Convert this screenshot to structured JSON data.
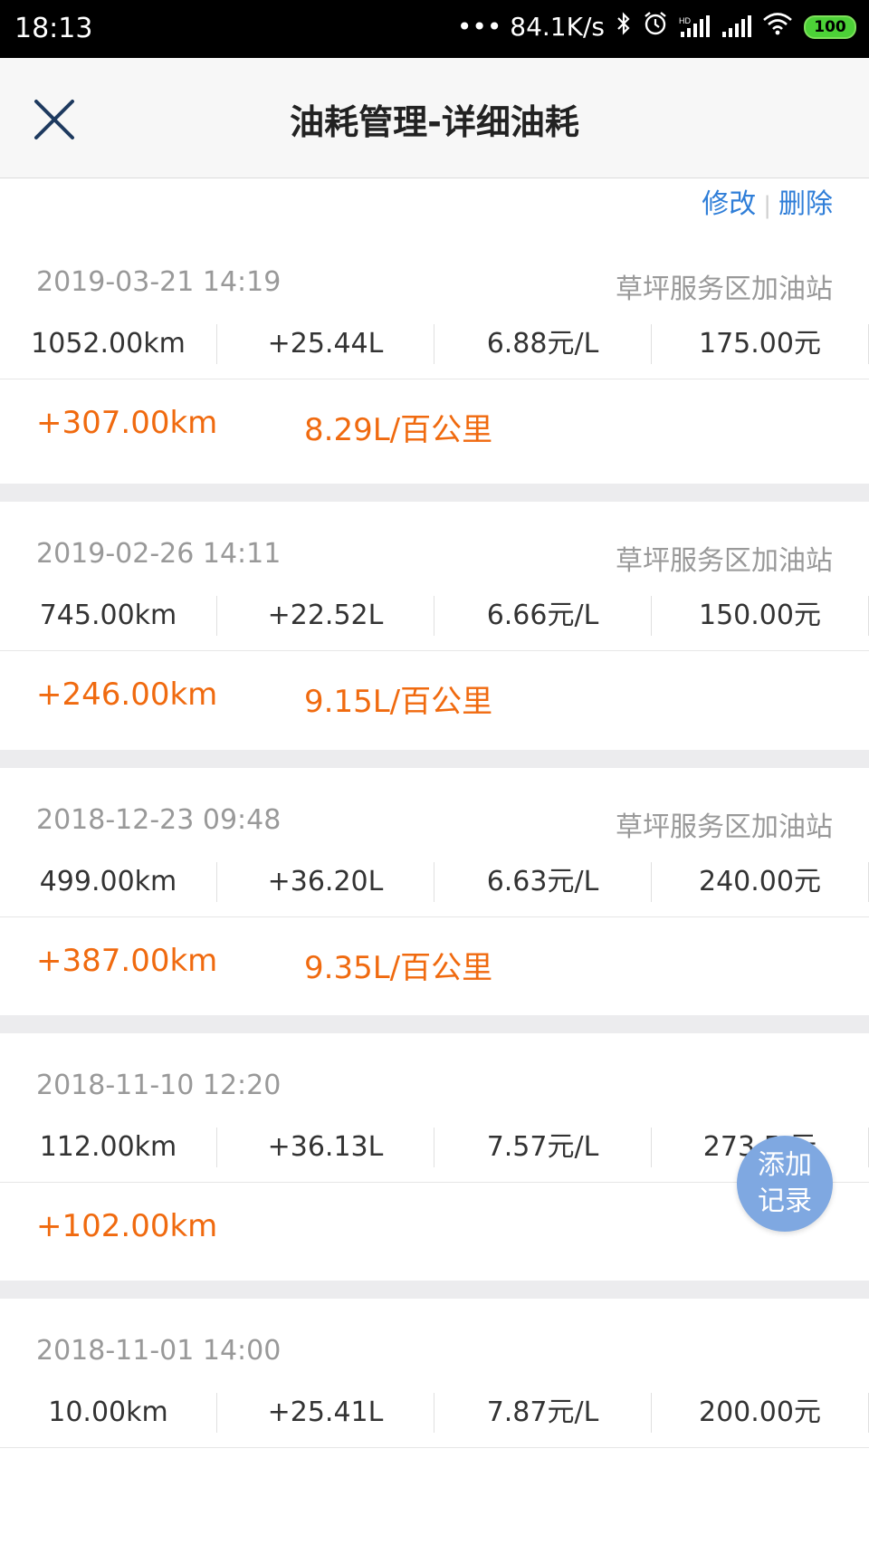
{
  "status_bar": {
    "time": "18:13",
    "network_speed": "••• 84.1K/s",
    "battery": "100",
    "icons": [
      "bluetooth-icon",
      "alarm-icon",
      "hd-signal-icon",
      "signal-icon",
      "wifi-icon"
    ]
  },
  "header": {
    "title": "油耗管理-详细油耗",
    "close_icon": "close-icon"
  },
  "actions": {
    "edit": "修改",
    "delete": "删除"
  },
  "records": [
    {
      "datetime": "2019-03-21 14:19",
      "station": "草坪服务区加油站",
      "odometer": "1052.00km",
      "fuel": "+25.44L",
      "price": "6.88元/L",
      "amount": "175.00元",
      "distance": "+307.00km",
      "consumption": "8.29L/百公里"
    },
    {
      "datetime": "2019-02-26 14:11",
      "station": "草坪服务区加油站",
      "odometer": "745.00km",
      "fuel": "+22.52L",
      "price": "6.66元/L",
      "amount": "150.00元",
      "distance": "+246.00km",
      "consumption": "9.15L/百公里"
    },
    {
      "datetime": "2018-12-23 09:48",
      "station": "草坪服务区加油站",
      "odometer": "499.00km",
      "fuel": "+36.20L",
      "price": "6.63元/L",
      "amount": "240.00元",
      "distance": "+387.00km",
      "consumption": "9.35L/百公里"
    },
    {
      "datetime": "2018-11-10 12:20",
      "station": "",
      "odometer": "112.00km",
      "fuel": "+36.13L",
      "price": "7.57元/L",
      "amount": "273.5 元",
      "distance": "+102.00km",
      "consumption": ""
    },
    {
      "datetime": "2018-11-01 14:00",
      "station": "",
      "odometer": "10.00km",
      "fuel": "+25.41L",
      "price": "7.87元/L",
      "amount": "200.00元"
    }
  ],
  "fab": {
    "line1": "添加",
    "line2": "记录"
  },
  "colors": {
    "accent_orange": "#f06a0f",
    "link_blue": "#2f7ed8",
    "fab_blue": "#7fa8e1"
  }
}
